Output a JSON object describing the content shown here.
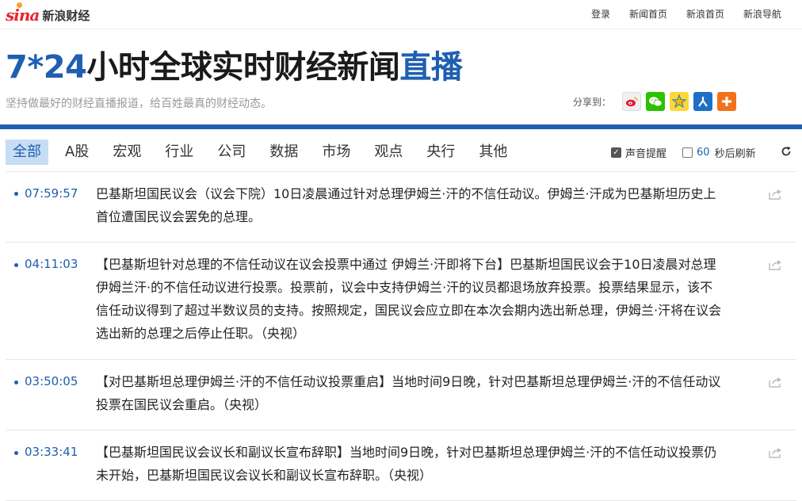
{
  "brand": {
    "logo_word": "sina",
    "logo_text": "新浪财经"
  },
  "topnav": [
    "登录",
    "新闻首页",
    "新浪首页",
    "新浪导航"
  ],
  "header": {
    "title_prefix": "7*24",
    "title_main": "小时全球实时财经新闻",
    "title_suffix": "直播",
    "tagline": "坚持做最好的财经直播报道，给百姓最真的财经动态。",
    "share_label": "分享到："
  },
  "tabs": [
    "全部",
    "A股",
    "宏观",
    "行业",
    "公司",
    "数据",
    "市场",
    "观点",
    "央行",
    "其他"
  ],
  "active_tab": "全部",
  "tools": {
    "sound_label": "声音提醒",
    "sound_on": true,
    "refresh_seconds": "60",
    "refresh_label": "秒后刷新",
    "auto_refresh_on": false
  },
  "feed": [
    {
      "time": "07:59:57",
      "text": "巴基斯坦国民议会（议会下院）10日凌晨通过针对总理伊姆兰·汗的不信任动议。伊姆兰·汗成为巴基斯坦历史上首位遭国民议会罢免的总理。"
    },
    {
      "time": "04:11:03",
      "text": "【巴基斯坦针对总理的不信任动议在议会投票中通过 伊姆兰·汗即将下台】巴基斯坦国民议会于10日凌晨对总理伊姆兰汗·的不信任动议进行投票。投票前，议会中支持伊姆兰·汗的议员都退场放弃投票。投票结果显示，该不信任动议得到了超过半数议员的支持。按照规定，国民议会应立即在本次会期内选出新总理，伊姆兰·汗将在议会选出新的总理之后停止任职。（央视）"
    },
    {
      "time": "03:50:05",
      "text": "【对巴基斯坦总理伊姆兰·汗的不信任动议投票重启】当地时间9日晚，针对巴基斯坦总理伊姆兰·汗的不信任动议投票在国民议会重启。（央视）"
    },
    {
      "time": "03:33:41",
      "text": "【巴基斯坦国民议会议长和副议长宣布辞职】当地时间9日晚，针对巴基斯坦总理伊姆兰·汗的不信任动议投票仍未开始，巴基斯坦国民议会议长和副议长宣布辞职。（央视）"
    }
  ],
  "colors": {
    "accent": "#1f5fb0",
    "active_tab_bg": "#c7ddf4"
  }
}
